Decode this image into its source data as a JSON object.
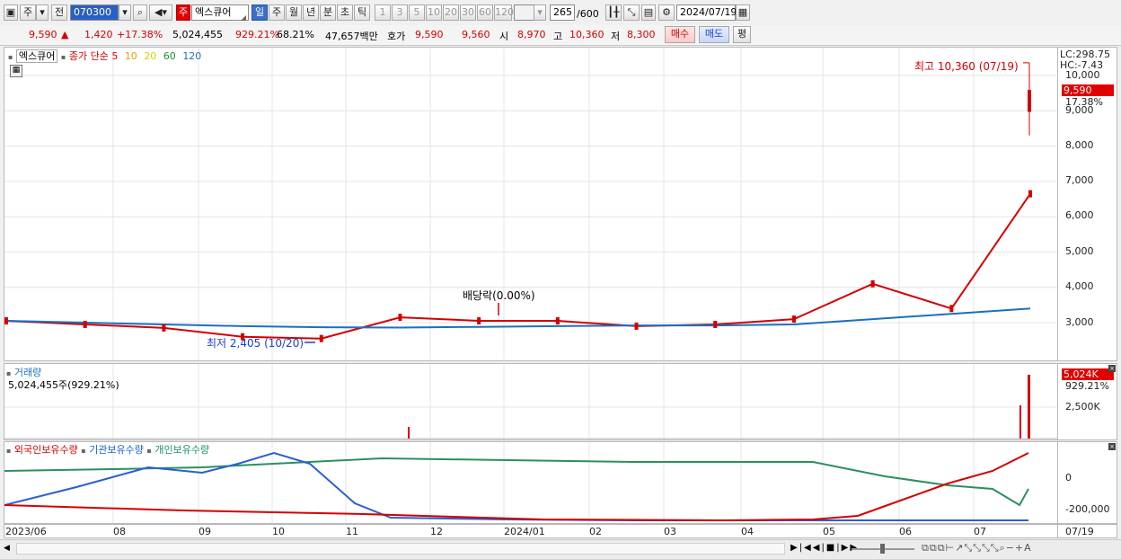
{
  "toolbar": {
    "market": "주",
    "prev": "전",
    "code": "070300",
    "stock_badge": "주",
    "stock_name": "엑스큐어",
    "periods": [
      "일",
      "주",
      "월",
      "년",
      "분",
      "초",
      "틱"
    ],
    "intervals": [
      "1",
      "3",
      "5",
      "10",
      "20",
      "30",
      "60",
      "120"
    ],
    "count_current": "265",
    "count_total": "/600",
    "date": "2024/07/19"
  },
  "quote": {
    "price": "9,590",
    "change": "1,420",
    "change_pct": "+17.38%",
    "volume": "5,024,455",
    "volume_ratio": "929.21%",
    "turnover": "68.21%",
    "amount": "47,657백만",
    "hoga_label": "호가",
    "ask": "9,590",
    "bid": "9,560",
    "open_label": "시",
    "open": "8,970",
    "high_label": "고",
    "high": "10,360",
    "low_label": "저",
    "low": "8,300",
    "buy": "매수",
    "sell": "매도",
    "eval": "평"
  },
  "price_chart": {
    "legend_name": "엑스큐어",
    "legend_type": "종가 단순",
    "ma_labels": [
      "5",
      "10",
      "20",
      "60",
      "120"
    ],
    "ma_colors": [
      "#d40000",
      "#e8a000",
      "#e8e000",
      "#1a9030",
      "#1a70c0"
    ],
    "lc": "LC:298.75",
    "hc": "HC:-7.43",
    "current_tag": "9,590",
    "current_pct": "17.38%",
    "high_annot": "최고 10,360 (07/19)",
    "low_annot": "최저 2,405 (10/20)",
    "dividend_annot": "배당락(0.00%)",
    "y_ticks": [
      "10,000",
      "9,000",
      "8,000",
      "7,000",
      "6,000",
      "5,000",
      "4,000",
      "3,000"
    ]
  },
  "volume_chart": {
    "title": "거래량",
    "value": "5,024,455주(929.21%)",
    "tag": "5,024K",
    "tag_pct": "929.21%",
    "y_tick": "2,500K"
  },
  "holdings_chart": {
    "legend": [
      "외국인보유수량",
      "기관보유수량",
      "개인보유수량"
    ],
    "y_ticks": [
      "0",
      "-200,000"
    ]
  },
  "x_axis": {
    "labels": [
      "2023/06",
      "08",
      "09",
      "10",
      "11",
      "12",
      "2024/01",
      "02",
      "03",
      "04",
      "05",
      "06",
      "07"
    ],
    "right_label": "07/19"
  },
  "chart_data": {
    "type": "line",
    "title": "엑스큐어",
    "ylabel": "",
    "ylim": [
      2000,
      10600
    ],
    "x": [
      "2023/06",
      "08",
      "09",
      "10",
      "11",
      "12",
      "2024/01",
      "02",
      "03",
      "04",
      "05",
      "06",
      "07",
      "07/19"
    ],
    "series": [
      {
        "name": "5",
        "values": [
          3050,
          2950,
          2850,
          2600,
          2550,
          3150,
          3050,
          3050,
          2900,
          2950,
          3100,
          4100,
          3400,
          6650
        ]
      },
      {
        "name": "120",
        "values": [
          3050,
          3000,
          2950,
          2900,
          2870,
          2860,
          2880,
          2900,
          2920,
          2920,
          2950,
          3100,
          3250,
          3400
        ]
      }
    ],
    "annotations": [
      "최고 10,360 (07/19)",
      "최저 2,405 (10/20)",
      "배당락(0.00%)"
    ]
  }
}
